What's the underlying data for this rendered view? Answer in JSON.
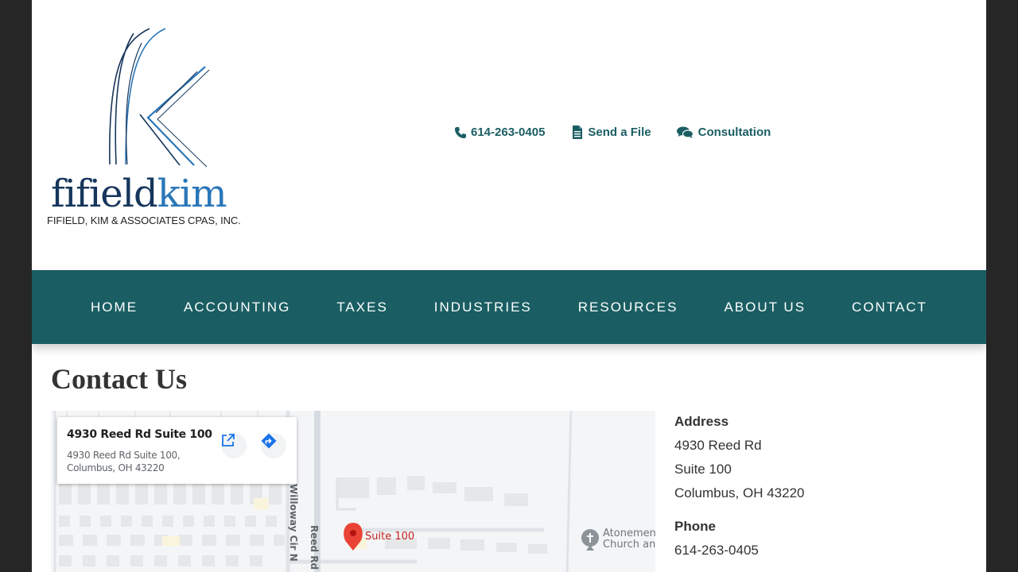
{
  "brand": {
    "word_part1": "fifield",
    "word_part2": "kim",
    "tagline": "FIFIELD, KIM & ASSOCIATES CPAS, INC."
  },
  "top_links": [
    {
      "label": "614-263-0405",
      "icon": "phone-icon"
    },
    {
      "label": "Send a File",
      "icon": "file-icon"
    },
    {
      "label": "Consultation",
      "icon": "chat-icon"
    }
  ],
  "nav": [
    "HOME",
    "ACCOUNTING",
    "TAXES",
    "INDUSTRIES",
    "RESOURCES",
    "ABOUT US",
    "CONTACT"
  ],
  "page_title": "Contact Us",
  "map": {
    "card_title": "4930 Reed Rd Suite 100",
    "card_line1": "4930 Reed Rd Suite 100,",
    "card_line2": "Columbus, OH 43220",
    "pin_label": "Suite 100",
    "street1": "Willoway Cir N",
    "street2": "Reed Rd",
    "poi_line1": "Atonement",
    "poi_line2": "Church and"
  },
  "contact": {
    "address_heading": "Address",
    "address_line1": "4930 Reed Rd",
    "address_line2": "Suite 100",
    "address_line3": "Columbus, OH 43220",
    "phone_heading": "Phone",
    "phone": "614-263-0405"
  },
  "colors": {
    "brand_teal": "#1a5e63",
    "logo_navy": "#16365c",
    "logo_blue": "#2a77b8",
    "page_bg": "#262626",
    "pin_red": "#ea4335"
  }
}
